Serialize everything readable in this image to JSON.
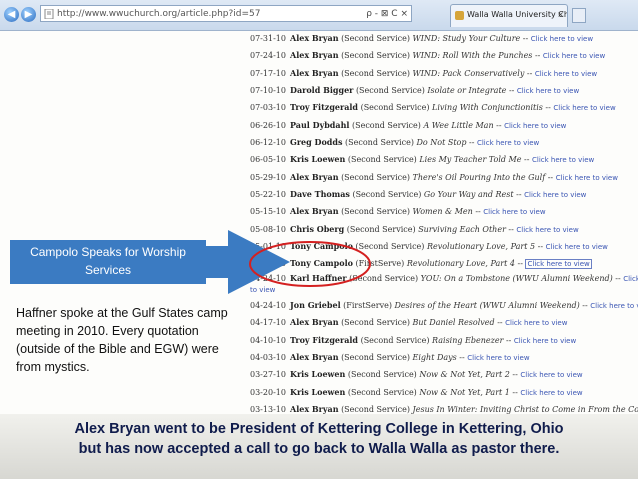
{
  "browser": {
    "url": "http://www.wwuchurch.org/article.php?id=57",
    "tools": "ρ - ⊠ C ×",
    "tab_title": "Walla Walla University Chur...",
    "tab_close": "×"
  },
  "sermons": [
    {
      "date": "07-31-10",
      "speaker": "Alex Bryan",
      "service": "(Second Service)",
      "title": "WIND: Study Your Culture",
      "link": "Click here to view"
    },
    {
      "date": "07-24-10",
      "speaker": "Alex Bryan",
      "service": "(Second Service)",
      "title": "WIND: Roll With the Punches",
      "link": "Click here to view"
    },
    {
      "date": "07-17-10",
      "speaker": "Alex Bryan",
      "service": "(Second Service)",
      "title": "WIND: Pack Conservatively",
      "link": "Click here to view"
    },
    {
      "date": "07-10-10",
      "speaker": "Darold Bigger",
      "service": "(Second Service)",
      "title": "Isolate or Integrate",
      "link": "Click here to view"
    },
    {
      "date": "07-03-10",
      "speaker": "Troy Fitzgerald",
      "service": "(Second Service)",
      "title": "Living With Conjunctionitis",
      "link": "Click here to view"
    },
    {
      "date": "06-26-10",
      "speaker": "Paul Dybdahl",
      "service": "(Second Service)",
      "title": "A Wee Little Man",
      "link": "Click here to view"
    },
    {
      "date": "06-12-10",
      "speaker": "Greg Dodds",
      "service": "(Second Service)",
      "title": "Do Not Stop",
      "link": "Click here to view"
    },
    {
      "date": "06-05-10",
      "speaker": "Kris Loewen",
      "service": "(Second Service)",
      "title": "Lies My Teacher Told Me",
      "link": "Click here to view"
    },
    {
      "date": "05-29-10",
      "speaker": "Alex Bryan",
      "service": "(Second Service)",
      "title": "There's Oil Pouring Into the Gulf",
      "link": "Click here to view"
    },
    {
      "date": "05-22-10",
      "speaker": "Dave Thomas",
      "service": "(Second Service)",
      "title": "Go Your Way and Rest",
      "link": "Click here to view"
    },
    {
      "date": "05-15-10",
      "speaker": "Alex Bryan",
      "service": "(Second Service)",
      "title": "Women & Men",
      "link": "Click here to view"
    },
    {
      "date": "05-08-10",
      "speaker": "Chris Oberg",
      "service": "(Second Service)",
      "title": "Surviving Each Other",
      "link": "Click here to view"
    },
    {
      "date": "05-01-10",
      "speaker": "Tony Campolo",
      "service": "(Second Service)",
      "title": "Revolutionary Love, Part 5",
      "link": "Click here to view"
    },
    {
      "date": "05-01-10",
      "speaker": "Tony Campolo",
      "service": "(FirstServe)",
      "title": "Revolutionary Love, Part 4",
      "link": "Click here to view"
    },
    {
      "date": "04-24-10",
      "speaker": "Karl Haffner",
      "service": "(Second Service)",
      "title": "YOU: On a Tombstone (WWU Alumni Weekend)",
      "link": "Click here",
      "link_cont": "to view"
    },
    {
      "date": "04-24-10",
      "speaker": "Jon Griebel",
      "service": "(FirstServe)",
      "title": "Desires of the Heart (WWU Alumni Weekend)",
      "link": "Click here to view"
    },
    {
      "date": "04-17-10",
      "speaker": "Alex Bryan",
      "service": "(Second Service)",
      "title": "But Daniel Resolved",
      "link": "Click here to view"
    },
    {
      "date": "04-10-10",
      "speaker": "Troy Fitzgerald",
      "service": "(Second Service)",
      "title": "Raising Ebenezer",
      "link": "Click here to view"
    },
    {
      "date": "04-03-10",
      "speaker": "Alex Bryan",
      "service": "(Second Service)",
      "title": "Eight Days",
      "link": "Click here to view"
    },
    {
      "date": "03-27-10",
      "speaker": "Kris Loewen",
      "service": "(Second Service)",
      "title": "Now & Not Yet, Part 2",
      "link": "Click here to view"
    },
    {
      "date": "03-20-10",
      "speaker": "Kris Loewen",
      "service": "(Second Service)",
      "title": "Now & Not Yet, Part 1",
      "link": "Click here to view"
    },
    {
      "date": "03-13-10",
      "speaker": "Alex Bryan",
      "service": "(Second Service)",
      "title": "Jesus In Winter: Inviting Christ to Come in From the Cold, Part",
      "link": ""
    }
  ],
  "callout": {
    "line1": "Campolo Speaks for Worship",
    "line2": "Services"
  },
  "note": "Haffner spoke at the Gulf States camp meeting in 2010.  Every quotation (outside of the Bible and EGW) were from mystics.",
  "caption": {
    "line1": "Alex Bryan went to be President of Kettering College in Kettering, Ohio",
    "line2": "but has now accepted a call to go back to Walla Walla as pastor there."
  },
  "colors": {
    "callout": "#3b7bc2",
    "arrow": "#3b7bc2",
    "circle": "#d42020",
    "link": "#3a55b3",
    "caption_text": "#101c4c"
  },
  "icons": {
    "back": "back-arrow-icon",
    "forward": "forward-arrow-icon",
    "page": "page-favicon",
    "tab": "site-favicon"
  }
}
